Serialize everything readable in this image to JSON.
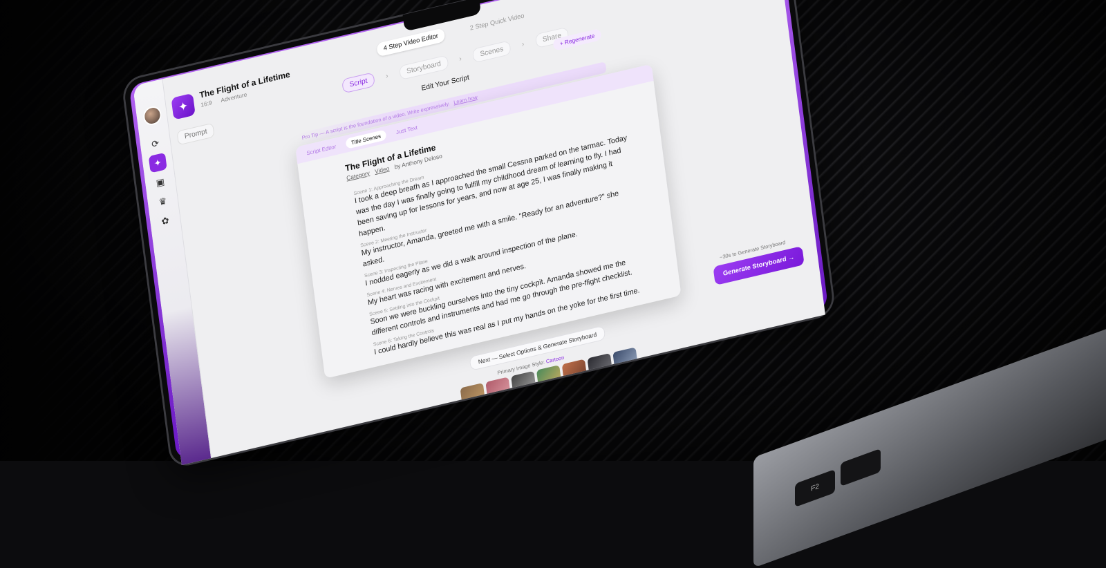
{
  "header": {
    "mode_tabs": [
      "4 Step Video Editor",
      "2 Step Quick Video"
    ],
    "project_title": "The Flight of a Lifetime",
    "aspect_ratio": "16:9",
    "genre": "Adventure",
    "prompt_label": "Prompt"
  },
  "steps": [
    {
      "label": "Script",
      "active": true
    },
    {
      "label": "Storyboard",
      "active": false
    },
    {
      "label": "Scenes",
      "active": false
    },
    {
      "label": "Share",
      "active": false
    }
  ],
  "editor": {
    "heading": "Edit Your Script",
    "regenerate_label": "Regenerate",
    "pro_tip": "Pro Tip — A script is the foundation of a video. Write expressively.",
    "learn_more": "Learn how",
    "tabs": [
      "Script Editor",
      "Title Scenes",
      "Just Text"
    ],
    "doc_title": "The Flight of a Lifetime",
    "category": "Category",
    "video": "Video",
    "author": "by Anthony Deloso",
    "scenes": [
      {
        "label": "Scene 1: Approaching the Dream",
        "text": "I took a deep breath as I approached the small Cessna parked on the tarmac. Today was the day I was finally going to fulfill my childhood dream of learning to fly. I had been saving up for lessons for years, and now at age 25, I was finally making it happen."
      },
      {
        "label": "Scene 2: Meeting the Instructor",
        "text": "My instructor, Amanda, greeted me with a smile. \"Ready for an adventure?\" she asked."
      },
      {
        "label": "Scene 3: Inspecting the Plane",
        "text": "I nodded eagerly as we did a walk around inspection of the plane."
      },
      {
        "label": "Scene 4: Nerves and Excitement",
        "text": "My heart was racing with excitement and nerves."
      },
      {
        "label": "Scene 5: Settling into the Cockpit",
        "text": "Soon we were buckling ourselves into the tiny cockpit. Amanda showed me the different controls and instruments and had me go through the pre-flight checklist."
      },
      {
        "label": "Scene 6: Taking the Controls",
        "text": "I could hardly believe this was real as I put my hands on the yoke for the first time."
      }
    ]
  },
  "footer": {
    "next_label": "Next — Select Options & Generate Storyboard",
    "style_prefix": "Primary Image Style:",
    "style_value": "Cartoon",
    "generate_hint": "~30s to Generate Storyboard",
    "generate_label": "Generate Storyboard"
  },
  "keyboard": {
    "f2": "F2"
  },
  "colors": {
    "accent": "#8a2be2",
    "accent_light": "#f3e8fd"
  }
}
